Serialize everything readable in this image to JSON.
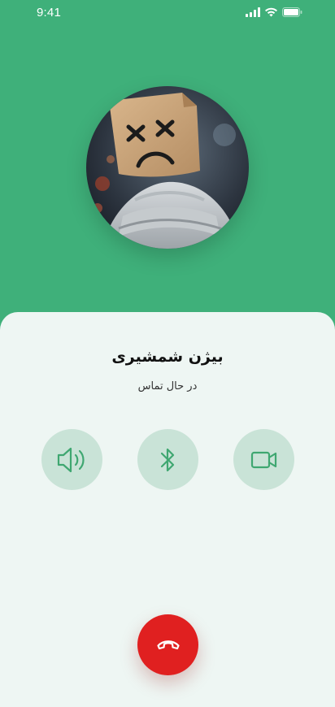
{
  "status_bar": {
    "time": "9:41",
    "icons": [
      "cellular-signal-icon",
      "wifi-icon",
      "battery-icon"
    ]
  },
  "call": {
    "avatar_icon": "contact-photo",
    "caller_name": "بیژن شمشیری",
    "status": "در حال تماس"
  },
  "controls": [
    {
      "icon": "speaker-icon"
    },
    {
      "icon": "bluetooth-icon"
    },
    {
      "icon": "video-camera-icon"
    }
  ],
  "end_call": {
    "icon": "hang-up-phone-icon"
  },
  "colors": {
    "header_green": "#3fb07a",
    "sheet_background": "#eef6f3",
    "control_background": "#c9e3d7",
    "icon_green": "#3fa771",
    "end_call_red": "#e02020"
  }
}
